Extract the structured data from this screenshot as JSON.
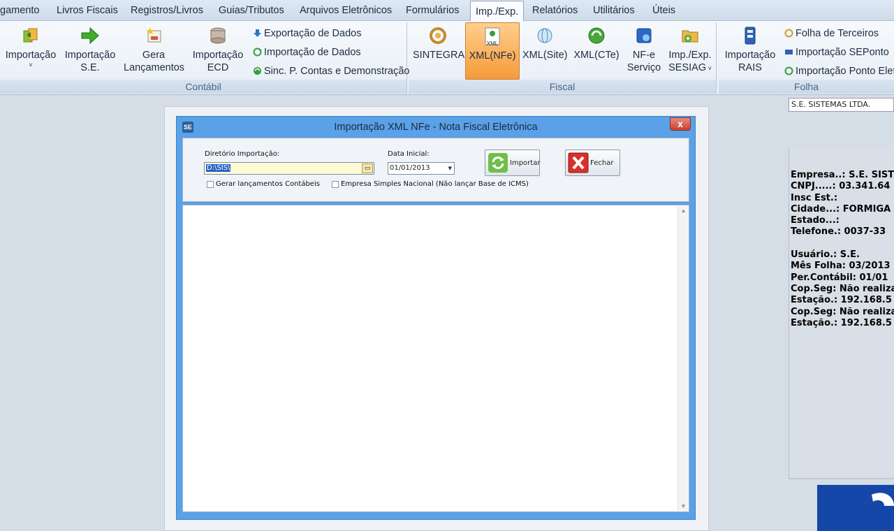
{
  "menu": {
    "items": [
      "gamento",
      "Livros Fiscais",
      "Registros/Livros",
      "Guias/Tributos",
      "Arquivos Eletrônicos",
      "Formulários",
      "Imp./Exp.",
      "Relatórios",
      "Utilitários",
      "Úteis"
    ],
    "active": "Imp./Exp."
  },
  "ribbon": {
    "contabil": {
      "label": "Contábil",
      "importacao": "Importação",
      "importacao_se_1": "Importação",
      "importacao_se_2": "S.E.",
      "gera_1": "Gera",
      "gera_2": "Lançamentos",
      "ecd_1": "Importação",
      "ecd_2": "ECD",
      "exportacao_dados": "Exportação de Dados",
      "importacao_dados": "Importação de Dados",
      "sinc": "Sinc. P. Contas e Demonstração"
    },
    "fiscal": {
      "label": "Fiscal",
      "sintegra": "SINTEGRA",
      "xml_nfe": "XML(NFe)",
      "xml_icon_text": "XML",
      "xml_site": "XML(Site)",
      "xml_cte": "XML(CTe)",
      "nfe_1": "NF-e",
      "nfe_2": "Serviço",
      "sesiag_1": "Imp./Exp.",
      "sesiag_2": "SESIAG"
    },
    "folha": {
      "label": "Folha",
      "rais_1": "Importação",
      "rais_2": "RAIS",
      "folha_terceiros": "Folha de Terceiros",
      "sep_onto": "Importação SEPonto",
      "ponto_eletr": "Importação Ponto Eletr"
    }
  },
  "company_name": "S.E. SISTEMAS LTDA.",
  "info": [
    "Empresa..:  S.E. SIST",
    "CNPJ.....:  03.341.64",
    "Insc Est.:",
    "Cidade...:  FORMIGA",
    "Estado...:",
    "Telefone.:  0037-33",
    "",
    "Usuário.:  S.E.",
    "Mês Folha:  03/2013",
    "Per.Contábil:  01/01",
    "Cop.Seg: Não realiza",
    "Estação.: 192.168.5",
    "Cop.Seg: Não realiza",
    "Estação.: 192.168.5"
  ],
  "dialog": {
    "app_icon_text": "SE",
    "title": "Importação XML NFe - Nota Fiscal Eletrônica",
    "close_label": "x",
    "dir_label": "Diretório Importação:",
    "dir_value": "D:\\SIS\\",
    "date_label": "Data Inicial:",
    "date_value": "01/01/2013",
    "chk_gerar": "Gerar lançamentos Contábeis",
    "chk_simples": "Empresa Simples Nacional (Não lançar Base de ICMS)",
    "btn_importar": "Importar",
    "btn_fechar": "Fechar"
  }
}
